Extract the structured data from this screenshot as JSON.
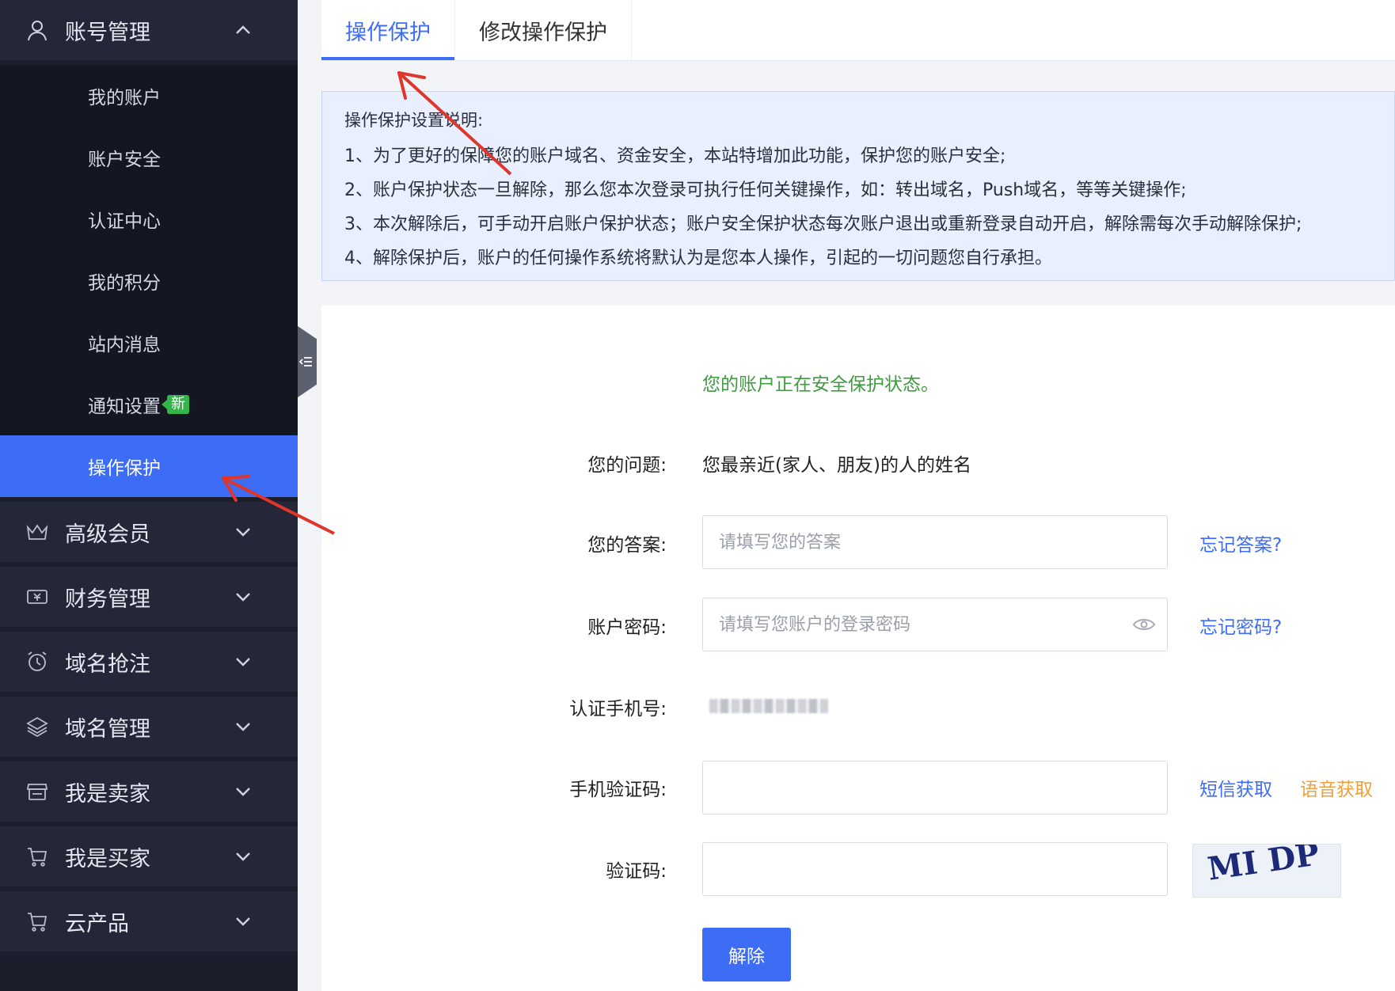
{
  "sidebar": {
    "account_group_label": "账号管理",
    "sub_items": [
      {
        "label": "我的账户"
      },
      {
        "label": "账户安全"
      },
      {
        "label": "认证中心"
      },
      {
        "label": "我的积分"
      },
      {
        "label": "站内消息"
      },
      {
        "label": "通知设置",
        "badge": "新"
      },
      {
        "label": "操作保护",
        "active": true
      }
    ],
    "groups": [
      {
        "label": "高级会员",
        "icon": "crown-icon"
      },
      {
        "label": "财务管理",
        "icon": "finance-icon"
      },
      {
        "label": "域名抢注",
        "icon": "clock-icon"
      },
      {
        "label": "域名管理",
        "icon": "layers-icon"
      },
      {
        "label": "我是卖家",
        "icon": "store-icon"
      },
      {
        "label": "我是买家",
        "icon": "cart-icon"
      },
      {
        "label": "云产品",
        "icon": "cart-icon"
      }
    ]
  },
  "tabs": [
    {
      "label": "操作保护",
      "active": true
    },
    {
      "label": "修改操作保护"
    }
  ],
  "notice": {
    "title": "操作保护设置说明:",
    "lines": [
      "1、为了更好的保障您的账户域名、资金安全，本站特增加此功能，保护您的账户安全;",
      "2、账户保护状态一旦解除，那么您本次登录可执行任何关键操作，如：转出域名，Push域名，等等关键操作;",
      "3、本次解除后，可手动开启账户保护状态；账户安全保护状态每次账户退出或重新登录自动开启，解除需每次手动解除保护;",
      "4、解除保护后，账户的任何操作系统将默认为是您本人操作，引起的一切问题您自行承担。"
    ]
  },
  "form": {
    "status_message": "您的账户正在安全保护状态。",
    "question_label": "您的问题:",
    "question_text": "您最亲近(家人、朋友)的人的姓名",
    "answer_label": "您的答案:",
    "answer_placeholder": "请填写您的答案",
    "forgot_answer": "忘记答案?",
    "password_label": "账户密码:",
    "password_placeholder": "请填写您账户的登录密码",
    "forgot_password": "忘记密码?",
    "phone_label": "认证手机号:",
    "sms_code_label": "手机验证码:",
    "sms_get": "短信获取",
    "voice_get": "语音获取",
    "captcha_label": "验证码:",
    "captcha_text": "MI DP",
    "submit_label": "解除"
  },
  "colors": {
    "accent": "#3d6cf5",
    "success": "#3f9b3f",
    "warning": "#f0a03a",
    "sidebar_bg": "#1b1e2b",
    "annotation_arrow": "#e0352b"
  }
}
